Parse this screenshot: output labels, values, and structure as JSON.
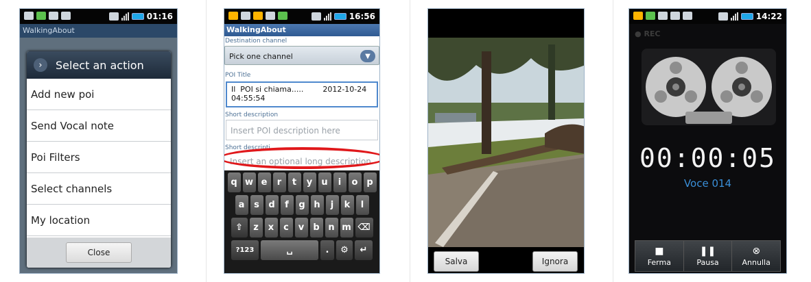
{
  "screens": [
    {
      "status_time": "01:16",
      "app_title": "WalkingAbout",
      "dialog_title": "Select an action",
      "items": [
        "Add new poi",
        "Send Vocal note",
        "Poi Filters",
        "Select channels",
        "My location"
      ],
      "close_label": "Close"
    },
    {
      "status_time": "16:56",
      "app_title": "WalkingAbout",
      "destination_label": "Destination channel",
      "destination_value": "Pick one channel",
      "poi_title_label": "POI Title",
      "poi_title_value": "Il  POI si chiama.....        2012-10-24\n04:55:54",
      "short_desc_label": "Short description",
      "short_desc_placeholder": "Insert POI description here",
      "long_desc_label": "Short descripti",
      "long_desc_placeholder": "Insert an optional long description",
      "keyboard": {
        "row1": [
          "q",
          "w",
          "e",
          "r",
          "t",
          "y",
          "u",
          "i",
          "o",
          "p"
        ],
        "row2": [
          "a",
          "s",
          "d",
          "f",
          "g",
          "h",
          "j",
          "k",
          "l"
        ],
        "row3": [
          "z",
          "x",
          "c",
          "v",
          "b",
          "n",
          "m"
        ],
        "sym_label": "?123",
        "period_label": "."
      }
    },
    {
      "save_label": "Salva",
      "ignore_label": "Ignora"
    },
    {
      "status_time": "14:22",
      "rec_label": "REC",
      "timer": "00:00:05",
      "recording_name": "Voce 014",
      "controls": [
        {
          "label": "Ferma",
          "icon": "stop-icon"
        },
        {
          "label": "Pausa",
          "icon": "pause-icon"
        },
        {
          "label": "Annulla",
          "icon": "cancel-icon"
        }
      ]
    }
  ],
  "colors": {
    "highlight_oval": "#e0181b",
    "recorder_accent": "#3a8fd8",
    "app_title_bar": "#2f5a92"
  }
}
